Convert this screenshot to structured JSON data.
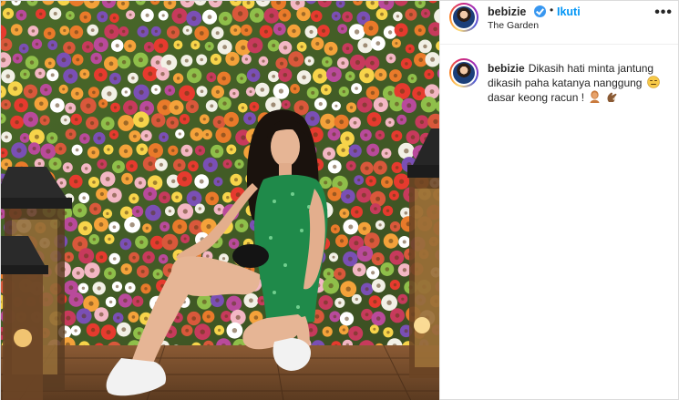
{
  "post": {
    "username": "bebizie",
    "verified": true,
    "separator": "•",
    "follow_label": "Ikuti",
    "location": "The Garden",
    "more_label": "•••"
  },
  "caption": {
    "username": "bebizie",
    "text": "Dikasih hati minta jantung dikasih paha katanya nanggung",
    "text_2": "dasar keong racun !",
    "emojis": [
      "expressionless-face",
      "woman-tipping-hand",
      "hand-ok"
    ]
  },
  "colors": {
    "accent_blue": "#0095f6",
    "verified_blue": "#3897f0",
    "border": "#dbdbdb",
    "text": "#262626"
  }
}
